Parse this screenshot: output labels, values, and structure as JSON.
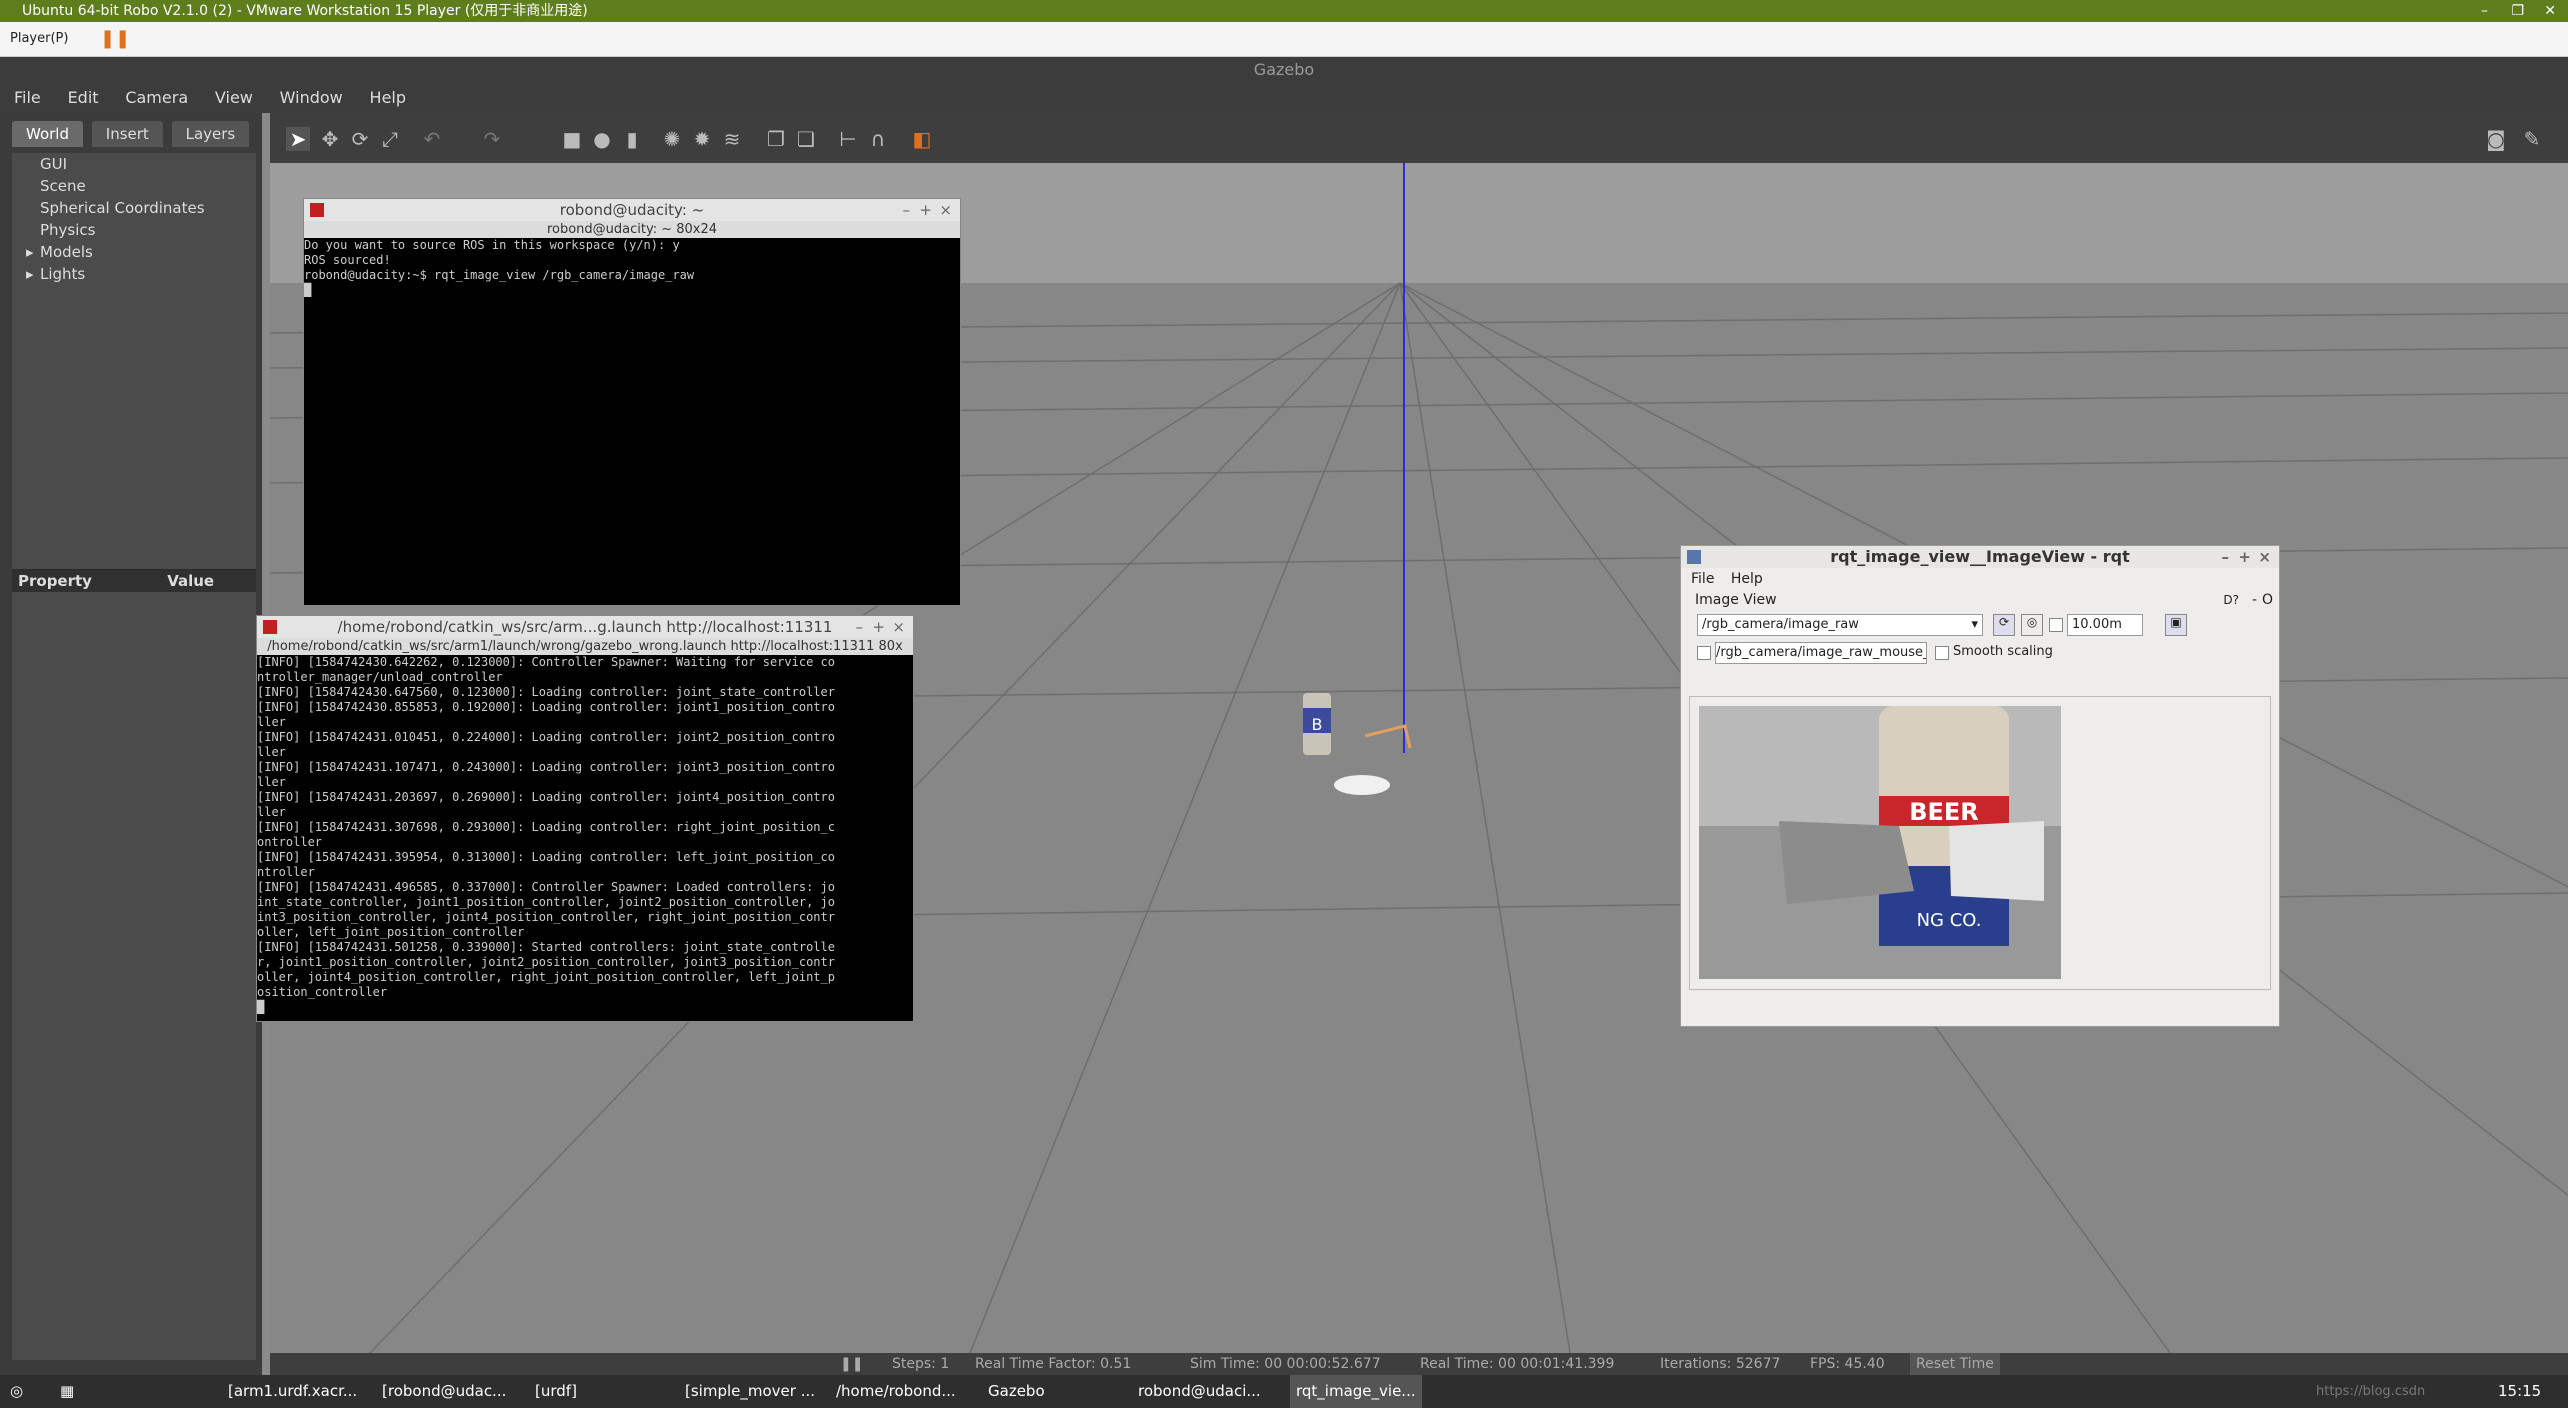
{
  "vmware": {
    "title": "Ubuntu 64-bit Robo V2.1.0 (2) - VMware Workstation 15 Player (仅用于非商业用途)",
    "player_menu": "Player(P)"
  },
  "gazebo": {
    "title": "Gazebo",
    "menu": [
      "File",
      "Edit",
      "Camera",
      "View",
      "Window",
      "Help"
    ],
    "tabs": [
      "World",
      "Insert",
      "Layers"
    ],
    "tree": [
      "GUI",
      "Scene",
      "Spherical Coordinates",
      "Physics",
      "Models",
      "Lights"
    ],
    "props": {
      "property": "Property",
      "value": "Value"
    },
    "status": {
      "steps": "Steps: 1",
      "rtf": "Real Time Factor: 0.51",
      "sim_time": "Sim Time: 00 00:00:52.677",
      "real_time": "Real Time: 00 00:01:41.399",
      "iterations": "Iterations: 52677",
      "fps": "FPS: 45.40",
      "reset": "Reset Time"
    }
  },
  "terminal1": {
    "title": "robond@udacity: ~",
    "subtitle": "robond@udacity: ~ 80x24",
    "lines": [
      "Do you want to source ROS in this workspace (y/n): y",
      "ROS sourced!",
      "robond@udacity:~$ rqt_image_view /rgb_camera/image_raw",
      "█"
    ]
  },
  "terminal2": {
    "title": "/home/robond/catkin_ws/src/arm...g.launch http://localhost:11311",
    "subtitle": "/home/robond/catkin_ws/src/arm1/launch/wrong/gazebo_wrong.launch http://localhost:11311 80x",
    "lines": [
      "[INFO] [1584742430.642262, 0.123000]: Controller Spawner: Waiting for service co",
      "ntroller_manager/unload_controller",
      "[INFO] [1584742430.647560, 0.123000]: Loading controller: joint_state_controller",
      "[INFO] [1584742430.855853, 0.192000]: Loading controller: joint1_position_contro",
      "ller",
      "[INFO] [1584742431.010451, 0.224000]: Loading controller: joint2_position_contro",
      "ller",
      "[INFO] [1584742431.107471, 0.243000]: Loading controller: joint3_position_contro",
      "ller",
      "[INFO] [1584742431.203697, 0.269000]: Loading controller: joint4_position_contro",
      "ller",
      "[INFO] [1584742431.307698, 0.293000]: Loading controller: right_joint_position_c",
      "ontroller",
      "[INFO] [1584742431.395954, 0.313000]: Loading controller: left_joint_position_co",
      "ntroller",
      "[INFO] [1584742431.496585, 0.337000]: Controller Spawner: Loaded controllers: jo",
      "int_state_controller, joint1_position_controller, joint2_position_controller, jo",
      "int3_position_controller, joint4_position_controller, right_joint_position_contr",
      "oller, left_joint_position_controller",
      "[INFO] [1584742431.501258, 0.339000]: Started controllers: joint_state_controlle",
      "r, joint1_position_controller, joint2_position_controller, joint3_position_contr",
      "oller, joint4_position_controller, right_joint_position_controller, left_joint_p",
      "osition_controller",
      "█"
    ]
  },
  "rqt": {
    "title": "rqt_image_view__ImageView - rqt",
    "menu": [
      "File",
      "Help"
    ],
    "panel": "Image View",
    "topic": "/rgb_camera/image_raw",
    "timeout": "10.00m",
    "mouse_topic": "/rgb_camera/image_raw_mouse_left",
    "smooth": "Smooth scaling",
    "can_text": "BEER",
    "can_text2": "NG CO."
  },
  "taskbar": {
    "items": [
      "[arm1.urdf.xacr...",
      "[robond@udac...",
      "[urdf]",
      "[simple_mover ...",
      "/home/robond...",
      "Gazebo",
      "robond@udaci...",
      "rqt_image_vie..."
    ],
    "time": "15:15",
    "watermark": "https://blog.csdn"
  }
}
